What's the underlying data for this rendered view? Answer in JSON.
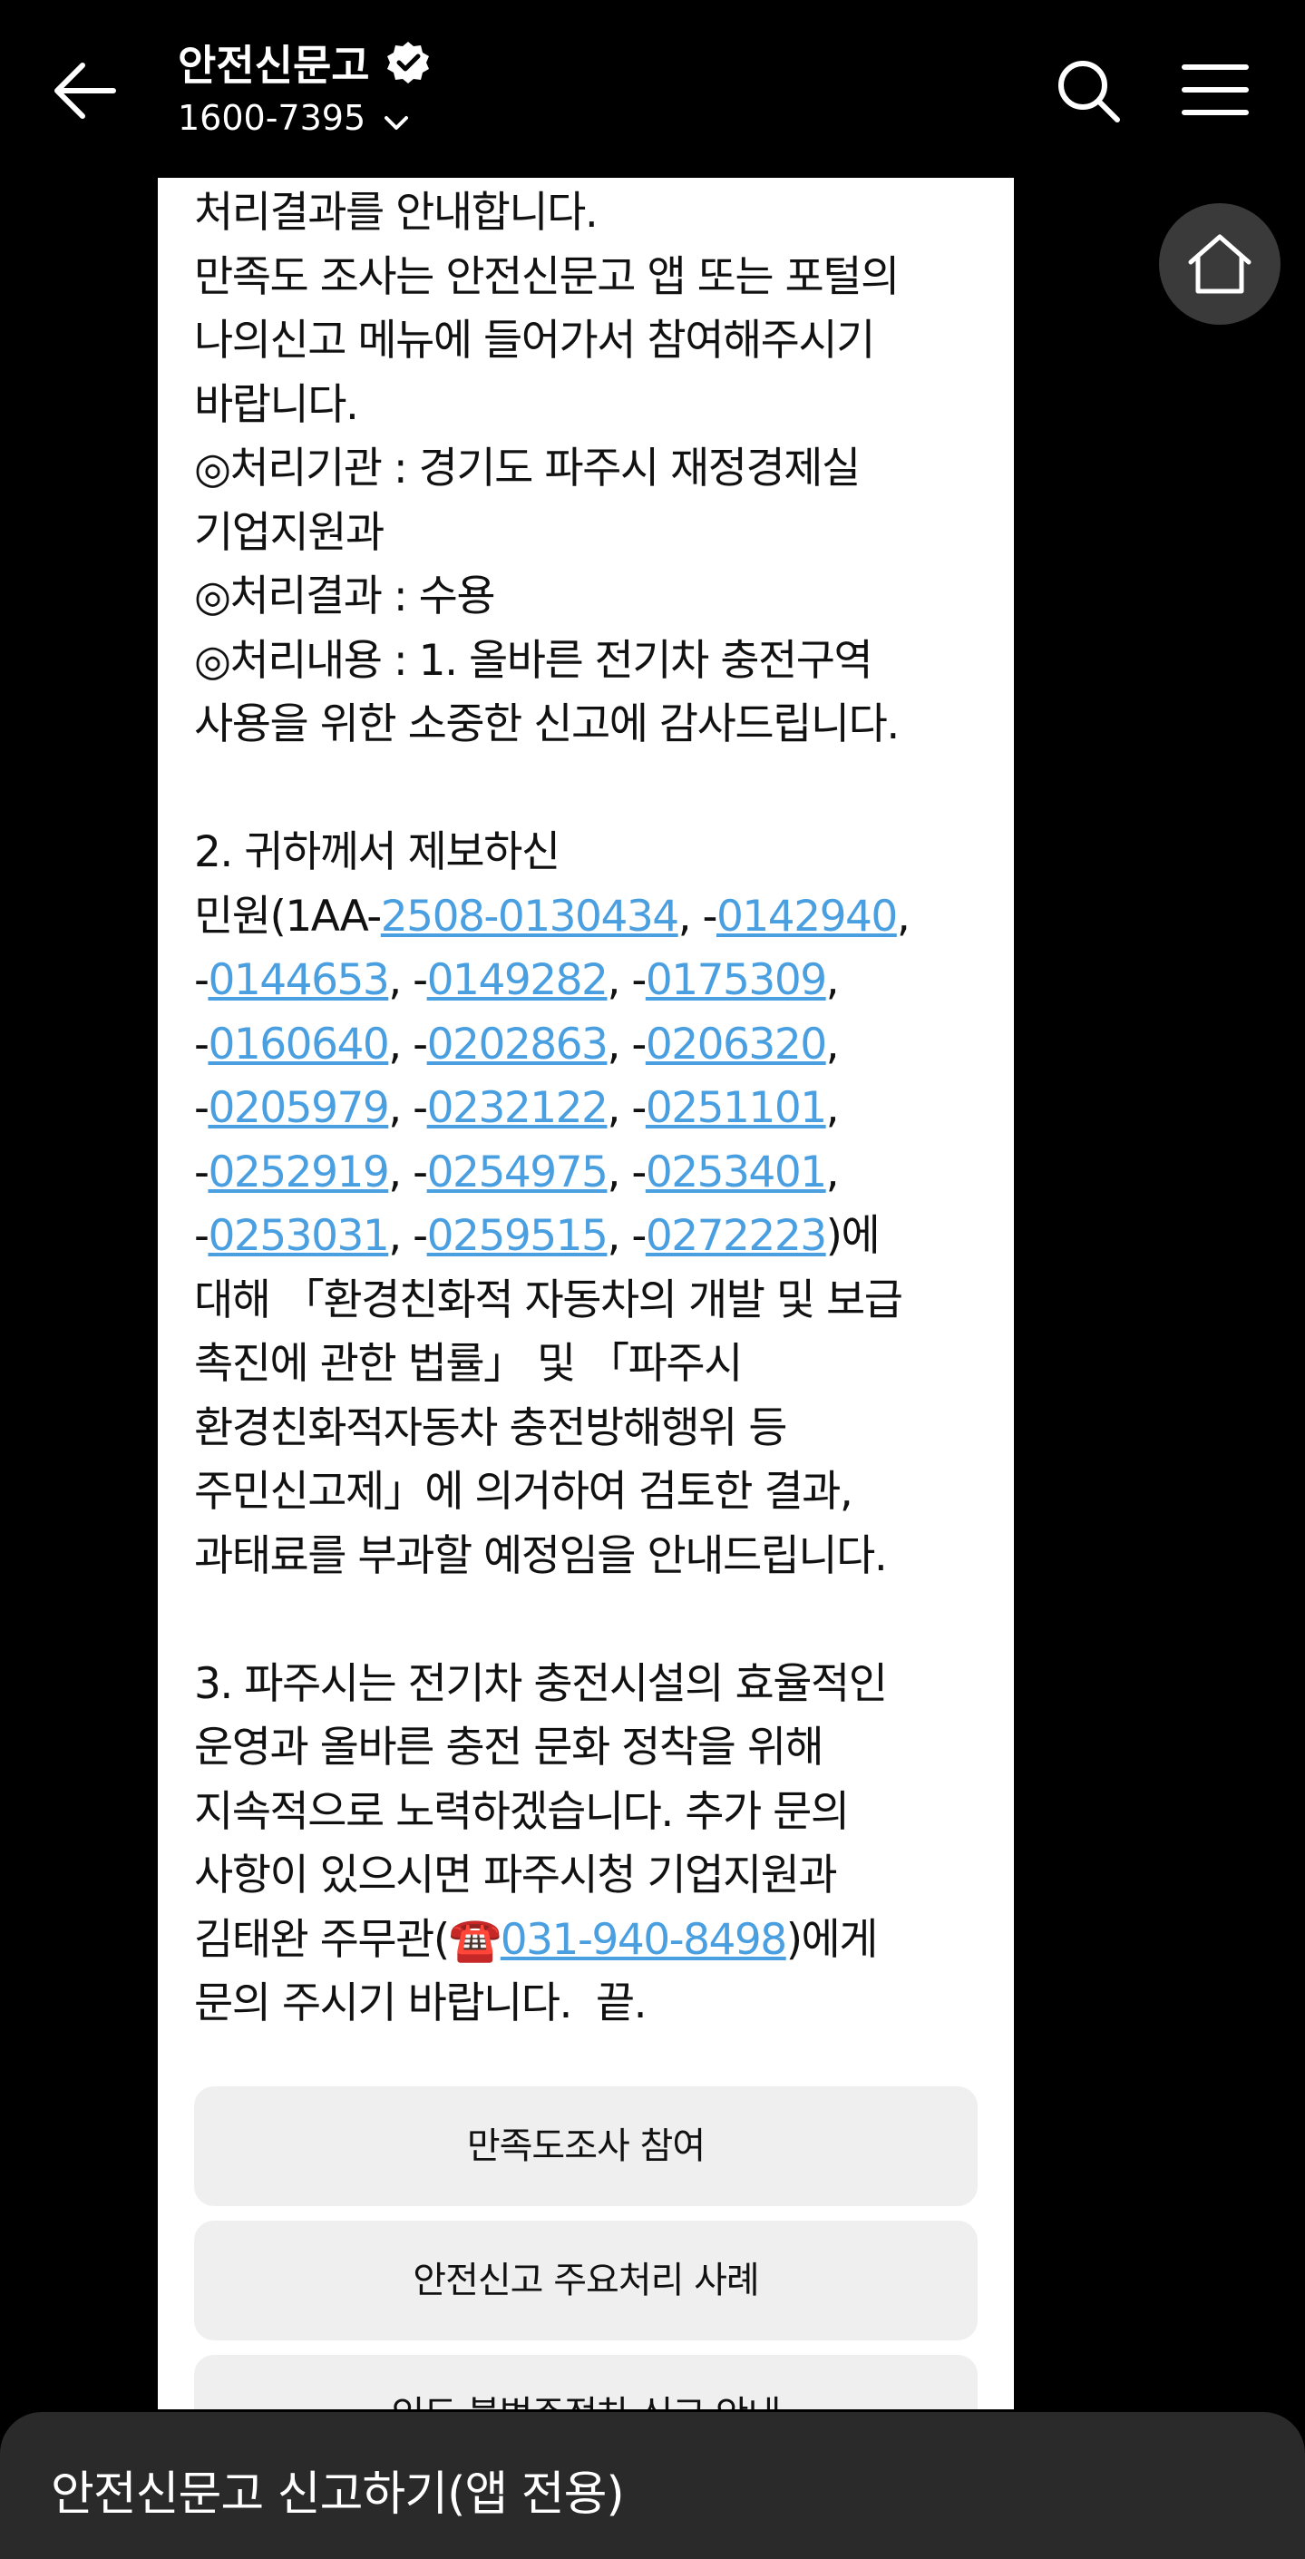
{
  "header": {
    "title": "안전신문고",
    "phone": "1600-7395"
  },
  "message": {
    "lines": [
      "처리결과를 안내합니다.",
      "만족도 조사는 안전신문고 앱 또는 포털의",
      "나의신고 메뉴에 들어가서 참여해주시기",
      "바랍니다.",
      "◎처리기관 : 경기도 파주시 재정경제실",
      "기업지원과",
      "◎처리결과 : 수용",
      "◎처리내용 : 1. 올바른 전기차 충전구역",
      "사용을 위한 소중한 신고에 감사드립니다.",
      "",
      "2. 귀하께서 제보하신"
    ],
    "complaint_prefix": "민원(1AA-",
    "complaint_ids": [
      "2508-0130434",
      "0142940",
      "0144653",
      "0149282",
      "0175309",
      "0160640",
      "0202863",
      "0206320",
      "0205979",
      "0232122",
      "0251101",
      "0252919",
      "0254975",
      "0253401",
      "0253031",
      "0259515",
      "0272223"
    ],
    "complaint_suffix": ")에",
    "lines_after": [
      "대해 「환경친화적 자동차의 개발 및 보급",
      "촉진에 관한 법률」 및 「파주시",
      "환경친화적자동차 충전방해행위 등",
      "주민신고제」에 의거하여 검토한 결과,",
      "과태료를 부과할 예정임을 안내드립니다.",
      "",
      "3. 파주시는 전기차 충전시설의 효율적인",
      "운영과 올바른 충전 문화 정착을 위해",
      "지속적으로 노력하겠습니다. 추가 문의",
      "사항이 있으시면 파주시청 기업지원과"
    ],
    "contact_prefix": "김태완 주무관(",
    "contact_phone_icon": "☎️",
    "contact_phone": "031-940-8498",
    "contact_suffix": ")에게",
    "closing": "문의 주시기 바랍니다.  끝."
  },
  "buttons": {
    "survey": "만족도조사 참여",
    "cases": "안전신고 주요처리 사례",
    "partial": "인도 불법주정차 신고 안내"
  },
  "bottom_bar": {
    "label": "안전신문고 신고하기(앱 전용)"
  },
  "colors": {
    "link": "#4a9fe0",
    "background": "#000000",
    "card": "#ffffff",
    "button": "#efefef",
    "bottom_bar": "#2a2a2a"
  }
}
